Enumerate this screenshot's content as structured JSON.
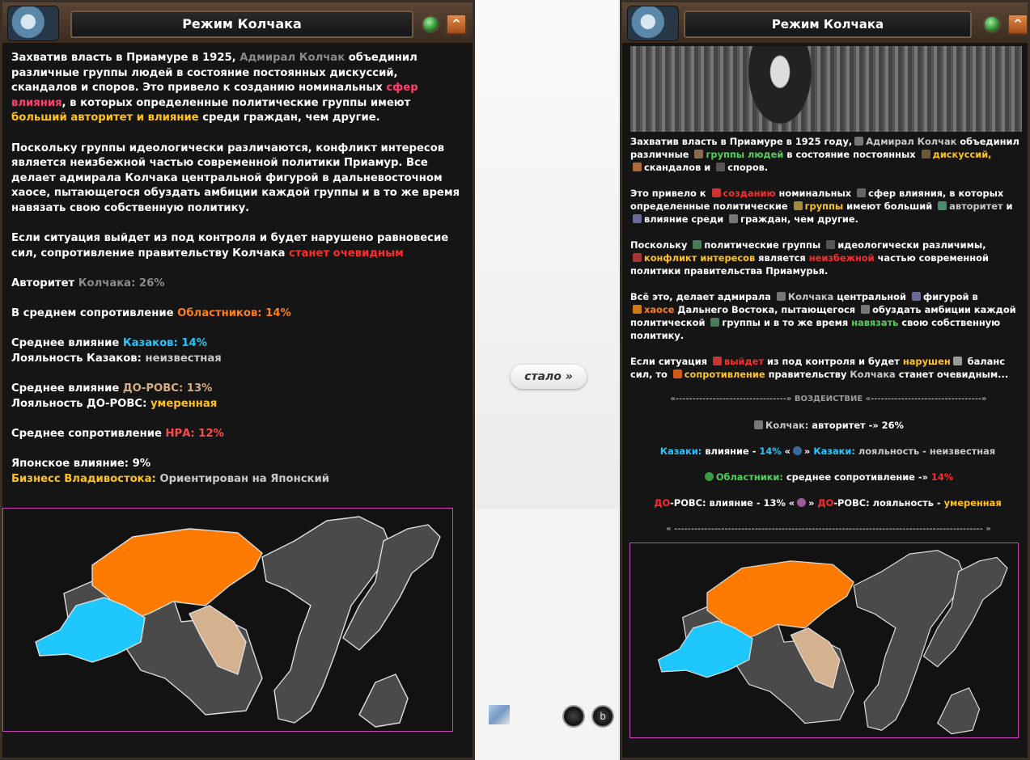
{
  "left": {
    "title": "Режим Колчака",
    "close_glyph": "^",
    "paragraphs": {
      "p1a": "Захватив власть в Приамуре в 1925, ",
      "p1b": "Адмирал Колчак",
      "p1c": " объединил различные группы людей в состояние постоянных дискуссий, скандалов и споров. Это привело к созданию номинальных ",
      "p1d": "сфер влияния",
      "p1e": ", в которых определенные политические группы имеют ",
      "p1f": "больший авторитет и влияние",
      "p1g": " среди граждан, чем другие.",
      "p2": "Поскольку группы идеологически различаются, конфликт интересов является неизбежной частью современной политики Приамур. Все делает адмирала Колчака центральной фигурой в дальневосточном хаосе, пытающегося обуздать амбиции каждой группы и в то же время навязать свою собственную политику.",
      "p3a": "Если ситуация выйдет из под контроля и будет нарушено равновесие сил, сопротивление правительству Колчака ",
      "p3b": "станет очевидным"
    },
    "stats": {
      "authority_label": "Авторитет ",
      "authority_value": "Колчака: 26%",
      "resist_label": "В среднем сопротивление ",
      "resist_value": "Областников: 14%",
      "cossack_inf_label": "Среднее влияние ",
      "cossack_inf_value": "Казаков: 14%",
      "cossack_loy_label": "Лояльность Казаков: ",
      "cossack_loy_value": "неизвестная",
      "rovs_inf_label": "Среднее влияние ",
      "rovs_inf_value": "ДО-РОВС: 13%",
      "rovs_loy_label": "Лояльность ДО-РОВС: ",
      "rovs_loy_value": "умеренная",
      "npa_label": "Среднее сопротивление ",
      "npa_value": "НРА: 12%",
      "japan": "Японское влияние: 9%",
      "biz_label": "Бизнесс Владивостока:",
      "biz_value": " Ориентирован на Японский"
    }
  },
  "middle": {
    "button": "стало »",
    "icon_b": "b"
  },
  "right": {
    "title": "Режим Колчака",
    "close_glyph": "^",
    "p1": {
      "a": "Захватив власть в Приамуре в 1925 году,",
      "b": "Адмирал Колчак",
      "c": " объединил различные ",
      "d": "группы людей",
      "e": " в состояние постоянных ",
      "f": "дискуссий,",
      "g": "скандалов и ",
      "h": "споров."
    },
    "p2": {
      "a": "Это привело к ",
      "b": "созданию",
      "c": " номинальных ",
      "d": "сфер влияния, в которых определенные политические ",
      "e": "группы",
      "f": " имеют больший ",
      "g": "авторитет",
      "h": " и ",
      "i": "влияние среди ",
      "j": "граждан, чем другие."
    },
    "p3": {
      "a": "Поскольку ",
      "b": "политические группы ",
      "c": "идеологически различимы,",
      "d": "конфликт интересов",
      "e": " является ",
      "f": "неизбежной",
      "g": " частью современной политики правительства Приамурья."
    },
    "p4": {
      "a": "Всё это, делает адмирала ",
      "b": "Колчака",
      "c": " центральной ",
      "d": "фигурой в ",
      "e": "хаосе",
      "f": " Дальнего Востока, пытающегося ",
      "g": "обуздать амбиции каждой политической ",
      "h": "группы",
      "i": " и в то же время ",
      "j": "навязать",
      "k": " свою собственную политику."
    },
    "p5": {
      "a": "Если ситуация ",
      "b": "выйдет",
      "c": " из под контроля и будет ",
      "d": "нарушен",
      "e": " баланс сил, то ",
      "f": "сопротивление",
      "g": " правительству ",
      "h": "Колчака",
      "i": " станет очевидным..."
    },
    "effects_header": "«---------------------------------» ВОЗДЕЙСТВИЕ «---------------------------------»",
    "effects_footer": "« -------------------------------------------------------------------------------------------- »",
    "effects": {
      "e1a": "Колчак:",
      "e1b": " авторитет -» 26%",
      "e2a": "Казаки:",
      "e2b": " влияние - ",
      "e2c": "14%",
      "e2d": " «",
      "e2e": "»",
      "e2f": "Казаки:",
      "e2g": " лояльность - неизвестная",
      "e3a": "Областники:",
      "e3b": " среднее сопротивление -» ",
      "e3c": "14%",
      "e4a": "ДО",
      "e4b": "-РОВС: влияние - 13% «",
      "e4c": "» ",
      "e4d": "ДО",
      "e4e": "-РОВС: лояльность - ",
      "e4f": "умеренная"
    }
  },
  "colors": {
    "orange": "#ff7a00",
    "cyan": "#1ec8ff",
    "tan": "#d5b28f",
    "land": "#4a4a4a",
    "frame": "#cc44bb"
  }
}
